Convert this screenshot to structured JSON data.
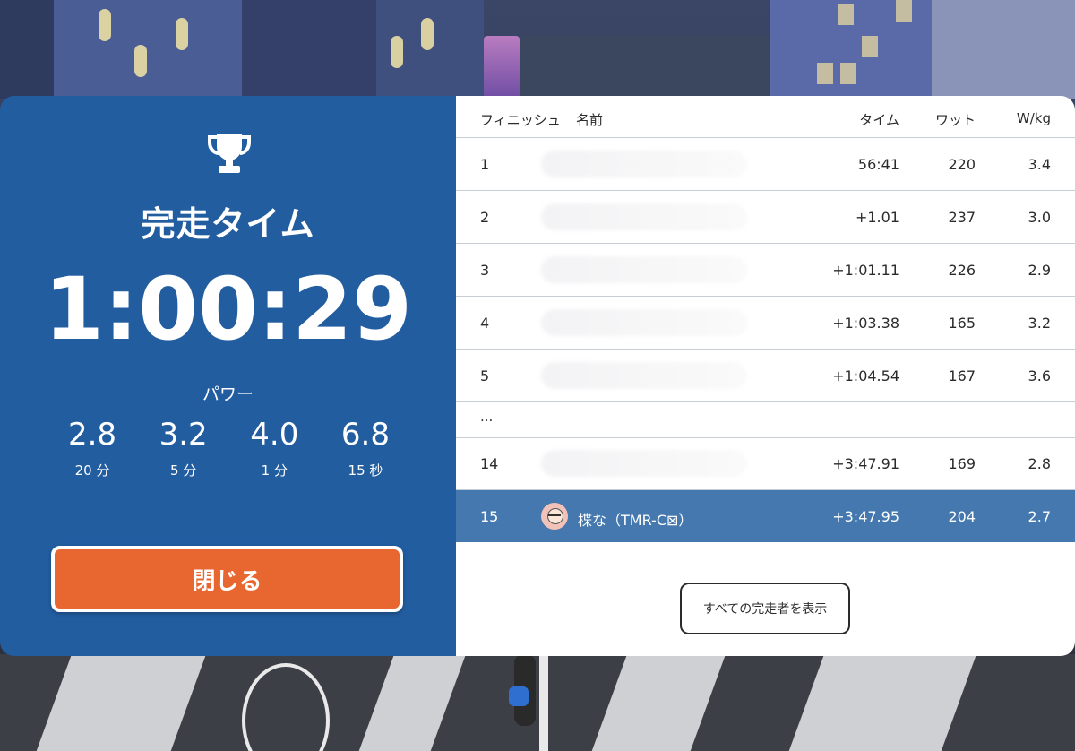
{
  "summary": {
    "title": "完走タイム",
    "finish_time": "1:00:29",
    "power_label": "パワー",
    "power": [
      {
        "value": "2.8",
        "duration": "20 分"
      },
      {
        "value": "3.2",
        "duration": "5 分"
      },
      {
        "value": "4.0",
        "duration": "1 分"
      },
      {
        "value": "6.8",
        "duration": "15 秒"
      }
    ],
    "close_label": "閉じる"
  },
  "table": {
    "headers": {
      "finish": "フィニッシュ",
      "name": "名前",
      "time": "タイム",
      "watt": "ワット",
      "wkg": "W/kg"
    },
    "rows": [
      {
        "rank": "1",
        "time": "56:41",
        "watt": "220",
        "wkg": "3.4"
      },
      {
        "rank": "2",
        "time": "+1.01",
        "watt": "237",
        "wkg": "3.0"
      },
      {
        "rank": "3",
        "time": "+1:01.11",
        "watt": "226",
        "wkg": "2.9"
      },
      {
        "rank": "4",
        "time": "+1:03.38",
        "watt": "165",
        "wkg": "3.2"
      },
      {
        "rank": "5",
        "time": "+1:04.54",
        "watt": "167",
        "wkg": "3.6"
      }
    ],
    "ellipsis": "...",
    "row14": {
      "rank": "14",
      "time": "+3:47.91",
      "watt": "169",
      "wkg": "2.8"
    },
    "highlight": {
      "rank": "15",
      "name": "楪な（TMR-C⊠）",
      "time": "+3:47.95",
      "watt": "204",
      "wkg": "2.7"
    },
    "show_all_label": "すべての完走者を表示"
  },
  "colors": {
    "panel_blue": "#225da0",
    "highlight_row": "#4478ae",
    "close_button": "#e86731"
  }
}
